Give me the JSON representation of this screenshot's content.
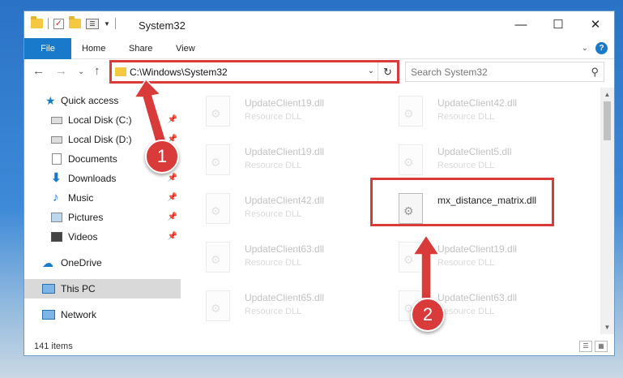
{
  "window": {
    "title": "System32",
    "min_label": "—",
    "max_label": "☐",
    "close_label": "✕"
  },
  "ribbon": {
    "tabs": [
      {
        "label": "File"
      },
      {
        "label": "Home"
      },
      {
        "label": "Share"
      },
      {
        "label": "View"
      }
    ],
    "expand_label": "⌄",
    "help_label": "?"
  },
  "address": {
    "path": "C:\\Windows\\System32",
    "back_label": "←",
    "forward_label": "→",
    "recent_label": "⌄",
    "up_label": "↑",
    "dropdown_label": "⌄",
    "refresh_label": "↻"
  },
  "search": {
    "placeholder": "Search System32",
    "icon": "⚲"
  },
  "nav": {
    "items": [
      {
        "label": "Quick access",
        "icon": "star-icon",
        "pinned": false
      },
      {
        "label": "Local Disk (C:)",
        "icon": "drive-icon",
        "pinned": true
      },
      {
        "label": "Local Disk (D:)",
        "icon": "drive-icon",
        "pinned": true
      },
      {
        "label": "Documents",
        "icon": "documents-icon",
        "pinned": true
      },
      {
        "label": "Downloads",
        "icon": "download-icon",
        "pinned": true
      },
      {
        "label": "Music",
        "icon": "music-icon",
        "pinned": true
      },
      {
        "label": "Pictures",
        "icon": "pictures-icon",
        "pinned": true
      },
      {
        "label": "Videos",
        "icon": "videos-icon",
        "pinned": true
      },
      {
        "label": "OneDrive",
        "icon": "cloud-icon",
        "pinned": false
      },
      {
        "label": "This PC",
        "icon": "computer-icon",
        "pinned": false,
        "selected": true
      },
      {
        "label": "Network",
        "icon": "network-icon",
        "pinned": false
      }
    ],
    "pin_glyph": "📌"
  },
  "files": [
    {
      "name": "UpdateClient19.dll",
      "type": "Resource DLL",
      "highlighted": false
    },
    {
      "name": "UpdateClient42.dll",
      "type": "Resource DLL",
      "highlighted": false
    },
    {
      "name": "UpdateClient19.dll",
      "type": "Resource DLL",
      "highlighted": false
    },
    {
      "name": "UpdateClient5.dll",
      "type": "Resource DLL",
      "highlighted": false
    },
    {
      "name": "UpdateClient42.dll",
      "type": "Resource DLL",
      "highlighted": false
    },
    {
      "name": "mx_distance_matrix.dll",
      "type": "",
      "highlighted": true
    },
    {
      "name": "UpdateClient63.dll",
      "type": "Resource DLL",
      "highlighted": false
    },
    {
      "name": "UpdateClient19.dll",
      "type": "Resource DLL",
      "highlighted": false
    },
    {
      "name": "UpdateClient65.dll",
      "type": "Resource DLL",
      "highlighted": false
    },
    {
      "name": "UpdateClient63.dll",
      "type": "Resource DLL",
      "highlighted": false
    }
  ],
  "status": {
    "count": "141 items"
  },
  "callouts": [
    {
      "number": "1"
    },
    {
      "number": "2"
    }
  ],
  "colors": {
    "accent": "#1979ca",
    "highlight_red": "#d93a3a",
    "selected_nav": "#d9d9d9"
  }
}
